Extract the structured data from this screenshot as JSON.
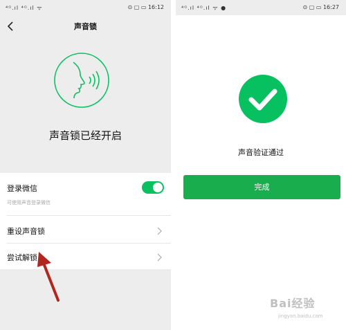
{
  "left_screen": {
    "status": {
      "signal": "⁴ᴳ.ıl ⁴ᴳ.ıl ᯤ",
      "icons": "⊙ ▢ ▭",
      "time": "16:12"
    },
    "nav": {
      "title": "声音锁",
      "back_icon": "chevron-left-icon"
    },
    "headline": "声音锁已经开启",
    "settings": {
      "login": {
        "label": "登录微信",
        "sublabel": "可使用声音登录微信",
        "enabled": true
      },
      "reset": {
        "label": "重设声音锁"
      },
      "try_unlock": {
        "label": "尝试解锁"
      }
    }
  },
  "right_screen": {
    "status": {
      "signal": "⁴ᴳ.ıl ⁴ᴳ.ıl ᯤ  ●",
      "icons": "⊙ ▢ ▭",
      "time": "16:27"
    },
    "result_text": "声音验证通过",
    "done_label": "完成"
  },
  "watermark": {
    "brand": "Bai经验",
    "url": "jingyan.baidu.com"
  },
  "colors": {
    "accent": "#07c160",
    "button": "#1aad4e",
    "arrow": "#b3261e",
    "background": "#ededed"
  }
}
